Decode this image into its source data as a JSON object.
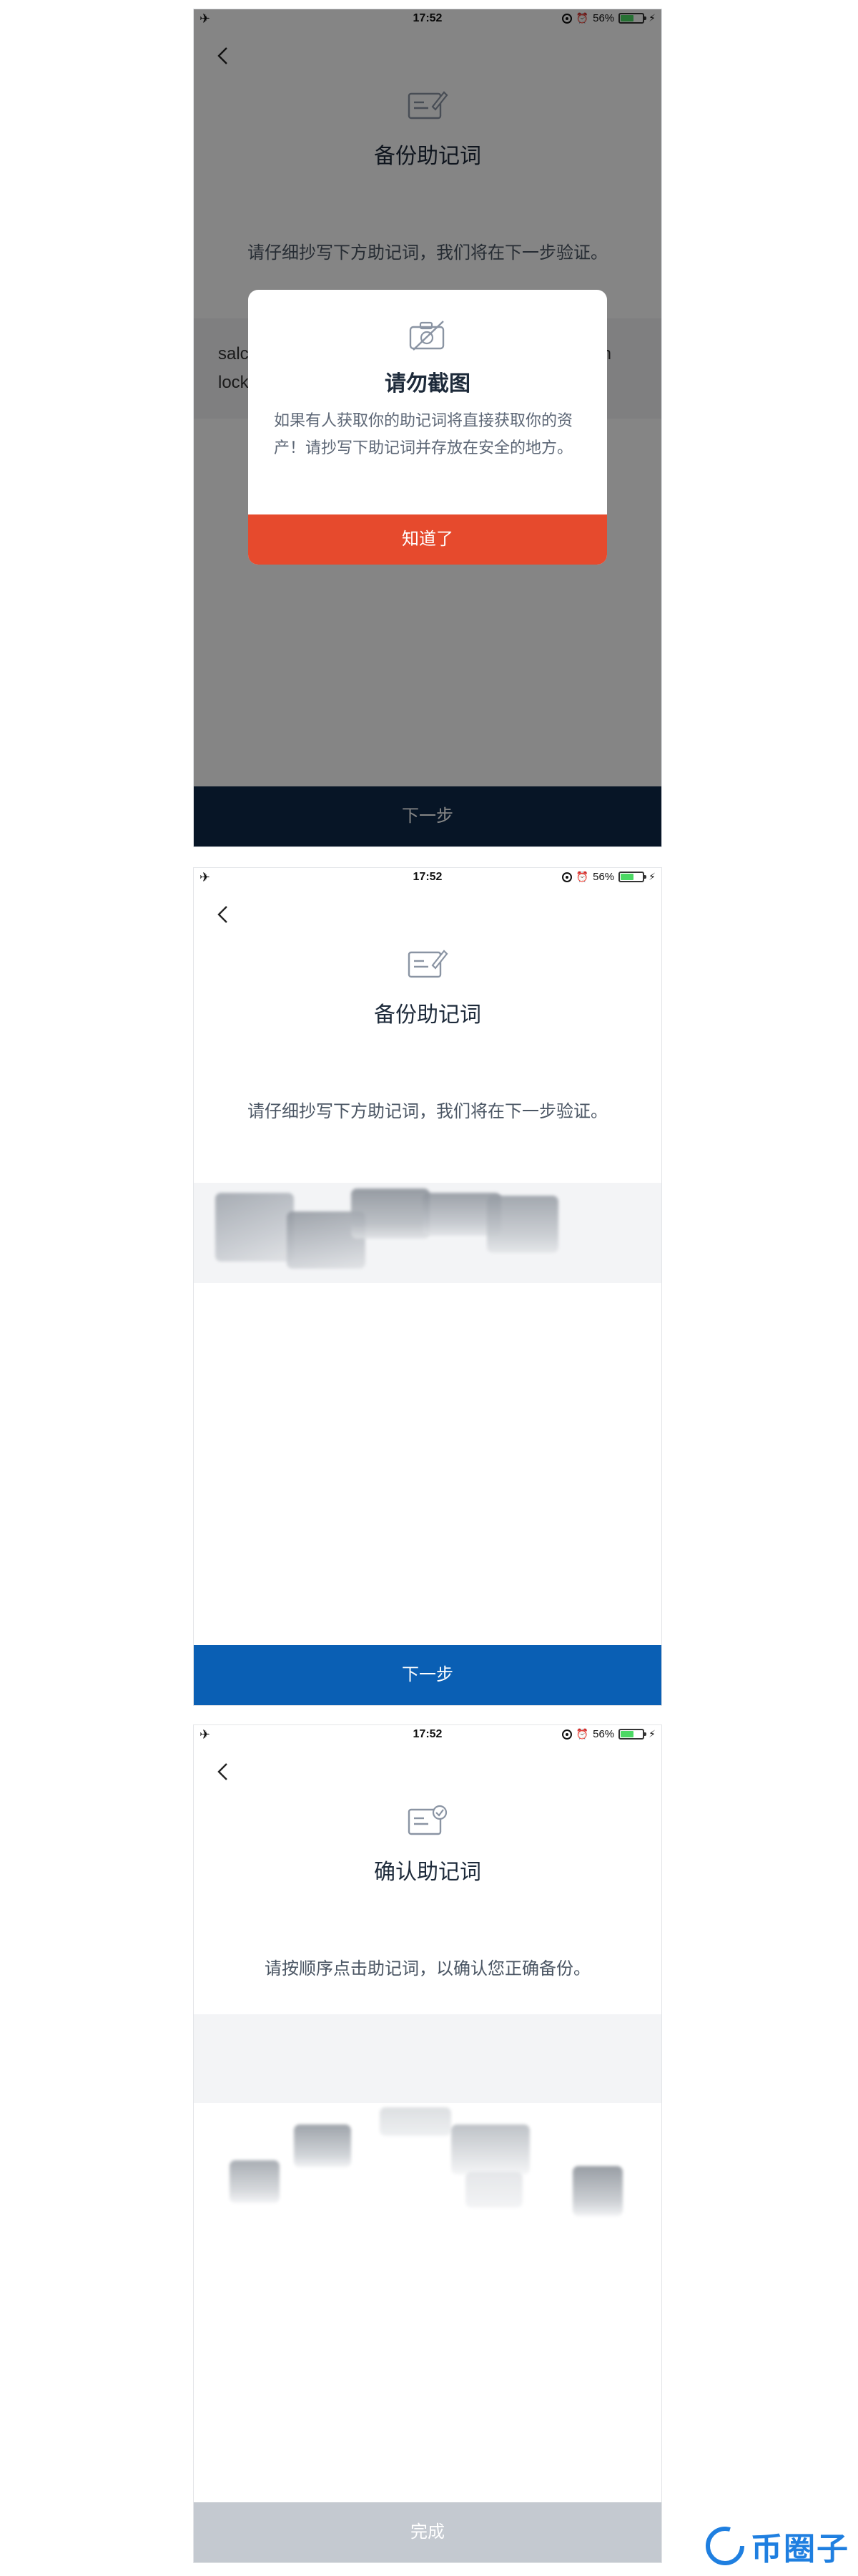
{
  "status_bar": {
    "time": "17:52",
    "battery": "56%",
    "battery_level": 0.56
  },
  "screen1": {
    "title": "备份助记词",
    "description": "请仔细抄写下方助记词，我们将在下一步验证。",
    "words_peek": [
      "salc",
      "lock",
      "n"
    ],
    "modal": {
      "title": "请勿截图",
      "text": "如果有人获取你的助记词将直接获取你的资产！请抄写下助记词并存放在安全的地方。",
      "button": "知道了"
    },
    "next_button": "下一步"
  },
  "screen2": {
    "title": "备份助记词",
    "description": "请仔细抄写下方助记词，我们将在下一步验证。",
    "next_button": "下一步"
  },
  "screen3": {
    "title": "确认助记词",
    "description": "请按顺序点击助记词，以确认您正确备份。",
    "done_button": "完成"
  },
  "watermark": {
    "text": "币圈子"
  },
  "colors": {
    "primary_blue": "#0a5fb4",
    "dark_navy": "#0e2a4a",
    "modal_red": "#e64a2d",
    "disabled_gray": "#c4c9d0"
  }
}
